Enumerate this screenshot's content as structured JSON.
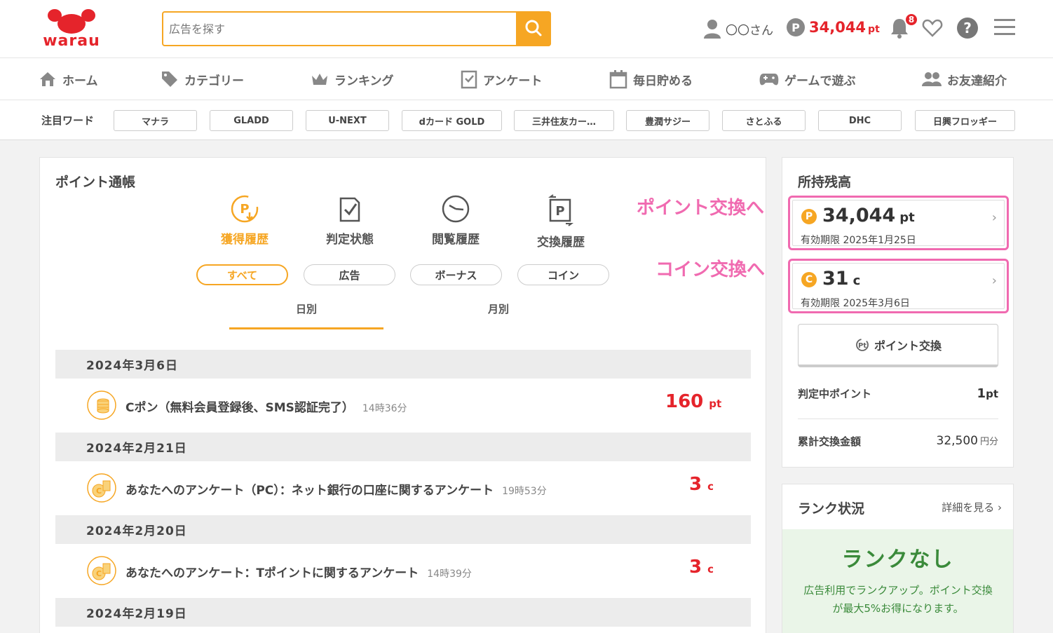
{
  "header": {
    "logo_text": "warau",
    "search_placeholder": "広告を探す",
    "user_name": "〇〇さん",
    "points_icon": "P",
    "points_value": "34,044",
    "points_unit": "pt",
    "notification_count": "8",
    "help_icon": "?"
  },
  "nav": {
    "items": [
      {
        "label": "ホーム",
        "icon": "home-icon"
      },
      {
        "label": "カテゴリー",
        "icon": "tag-icon"
      },
      {
        "label": "ランキング",
        "icon": "crown-icon"
      },
      {
        "label": "アンケート",
        "icon": "survey-icon"
      },
      {
        "label": "毎日貯める",
        "icon": "calendar-icon"
      },
      {
        "label": "ゲームで遊ぶ",
        "icon": "gamepad-icon"
      },
      {
        "label": "お友達紹介",
        "icon": "friends-icon"
      }
    ]
  },
  "keywords": {
    "label": "注目ワード",
    "items": [
      "マナラ",
      "GLADD",
      "U-NEXT",
      "dカード GOLD",
      "三井住友カー…",
      "豊潤サジー",
      "さとふる",
      "DHC",
      "日興フロッギー"
    ]
  },
  "passbook": {
    "title": "ポイント通帳",
    "history_tabs": [
      "獲得履歴",
      "判定状態",
      "閲覧履歴",
      "交換履歴"
    ],
    "filters": [
      "すべて",
      "広告",
      "ボーナス",
      "コイン"
    ],
    "period_tabs": [
      "日別",
      "月別"
    ],
    "groups": [
      {
        "date": "2024年3月6日",
        "entries": [
          {
            "title": "Cポン（無料会員登録後、SMS認証完了）",
            "time": "14時36分",
            "value": "160",
            "unit": "pt"
          }
        ]
      },
      {
        "date": "2024年2月21日",
        "entries": [
          {
            "title": "あなたへのアンケート（PC）：ネット銀行の口座に関するアンケート",
            "time": "19時53分",
            "value": "3",
            "unit": "c"
          }
        ]
      },
      {
        "date": "2024年2月20日",
        "entries": [
          {
            "title": "あなたへのアンケート：Tポイントに関するアンケート",
            "time": "14時39分",
            "value": "3",
            "unit": "c"
          }
        ]
      },
      {
        "date": "2024年2月19日",
        "entries": []
      }
    ]
  },
  "annotations": {
    "points": "ポイント交換へ",
    "coins": "コイン交換へ"
  },
  "balance": {
    "title": "所持残高",
    "points": {
      "icon": "P",
      "value": "34,044",
      "unit": "pt",
      "expiry": "有効期限 2025年1月25日"
    },
    "coins": {
      "icon": "C",
      "value": "31",
      "unit": "c",
      "expiry": "有効期限 2025年3月6日"
    },
    "exchange_button": "ポイント交換",
    "pending_label": "判定中ポイント",
    "pending_value": "1",
    "pending_unit": "pt",
    "total_label": "累計交換金額",
    "total_value": "32,500",
    "total_unit": "円分"
  },
  "rank": {
    "title": "ランク状況",
    "link": "詳細を見る",
    "status": "ランクなし",
    "description": "広告利用でランクアップ。ポイント交換が最大5%お得になります。"
  },
  "colors": {
    "accent": "#f6a623",
    "brand_red": "#e5242b",
    "annotation_pink": "#f06ab0",
    "rank_green": "#3a8a3a"
  }
}
